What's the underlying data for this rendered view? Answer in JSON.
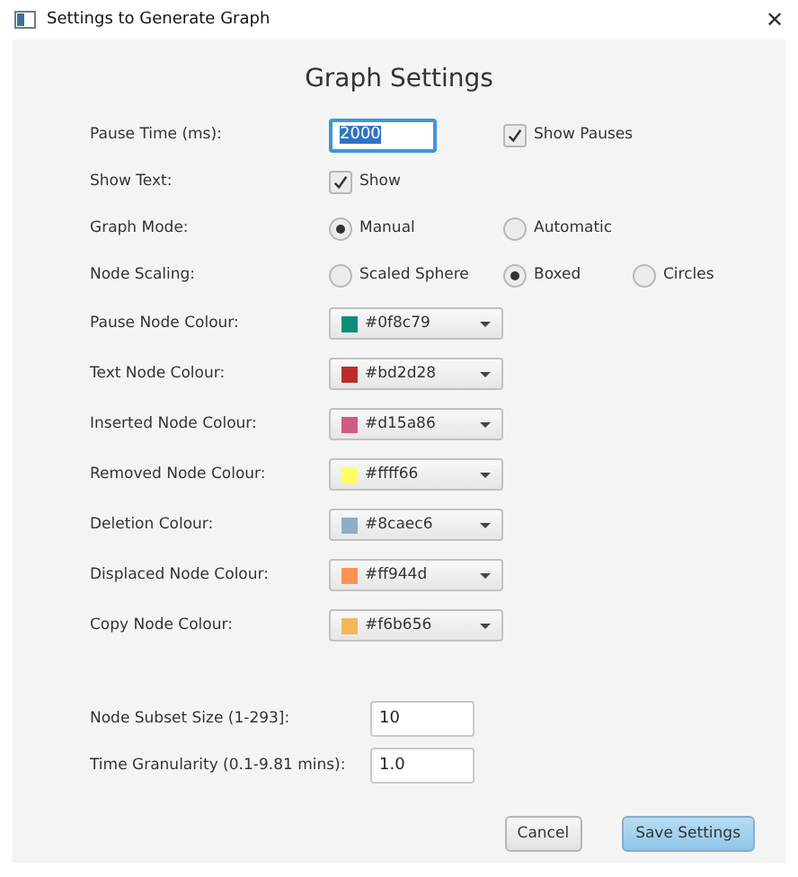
{
  "window": {
    "title": "Settings to Generate Graph",
    "close": "✕"
  },
  "heading": "Graph Settings",
  "settings": [
    {
      "label": "Pause Time (ms):",
      "controls": [
        {
          "kind": "field",
          "value": "2000",
          "focused": true
        },
        {
          "kind": "checkbox",
          "label": "Show Pauses",
          "checked": true
        }
      ]
    },
    {
      "label": "Show Text:",
      "controls": [
        {
          "kind": "checkbox",
          "label": "Show",
          "checked": true
        }
      ]
    },
    {
      "label": "Graph Mode:",
      "controls": [
        {
          "kind": "radio",
          "label": "Manual",
          "selected": true
        },
        {
          "kind": "radio",
          "label": "Automatic",
          "selected": false
        }
      ]
    },
    {
      "label": "Node Scaling:",
      "controls": [
        {
          "kind": "radio",
          "label": "Scaled Sphere",
          "selected": false
        },
        {
          "kind": "radio",
          "label": "Boxed",
          "selected": true
        },
        {
          "kind": "radio",
          "label": "Circles",
          "selected": false
        }
      ]
    },
    {
      "label": "Pause Node Colour:",
      "controls": [
        {
          "kind": "color",
          "value": "#0f8c79",
          "color": "#0f8c79"
        }
      ]
    },
    {
      "label": "Text Node Colour:",
      "controls": [
        {
          "kind": "color",
          "value": "#bd2d28",
          "color": "#bd2d28"
        }
      ]
    },
    {
      "label": "Inserted Node Colour:",
      "controls": [
        {
          "kind": "color",
          "value": "#d15a86",
          "color": "#d15a86"
        }
      ]
    },
    {
      "label": "Removed Node Colour:",
      "controls": [
        {
          "kind": "color",
          "value": "#ffff66",
          "color": "#ffff66"
        }
      ]
    },
    {
      "label": "Deletion Colour:",
      "controls": [
        {
          "kind": "color",
          "value": "#8caec6",
          "color": "#8caec6"
        }
      ]
    },
    {
      "label": "Displaced Node Colour:",
      "controls": [
        {
          "kind": "color",
          "value": "#ff944d",
          "color": "#ff944d"
        }
      ]
    },
    {
      "label": "Copy Node Colour:",
      "controls": [
        {
          "kind": "color",
          "value": "#f6b656",
          "color": "#f6b656"
        }
      ]
    }
  ],
  "limits": [
    {
      "label": "Node Subset Size (1-293]:",
      "value": "10"
    },
    {
      "label": "Time Granularity (0.1-9.81 mins):",
      "value": "1.0"
    }
  ],
  "buttons": [
    {
      "label": "Cancel",
      "default": false
    },
    {
      "label": "Save Settings",
      "default": true
    }
  ]
}
